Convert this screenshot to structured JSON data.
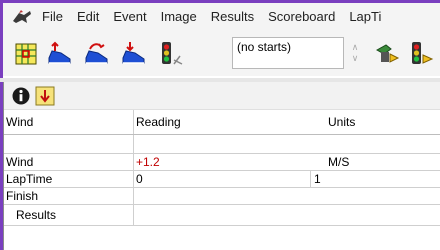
{
  "menu": {
    "items": [
      "File",
      "Edit",
      "Event",
      "Image",
      "Results",
      "Scoreboard",
      "LapTi"
    ]
  },
  "toolbar": {
    "combo_value": "(no starts)"
  },
  "grid": {
    "headers": {
      "name": "Wind",
      "reading": "Reading",
      "units": "Units"
    },
    "rows": [
      {
        "name": "Wind",
        "reading": "+1.2",
        "units": "M/S"
      },
      {
        "name": "LapTime",
        "reading": "0",
        "extra": "1",
        "units": ""
      },
      {
        "name": "Finish",
        "reading": "",
        "units": ""
      },
      {
        "name": "Results",
        "reading": "",
        "units": ""
      }
    ]
  },
  "colors": {
    "accent": "#7a3fbf",
    "reading_highlight": "#c00000"
  }
}
